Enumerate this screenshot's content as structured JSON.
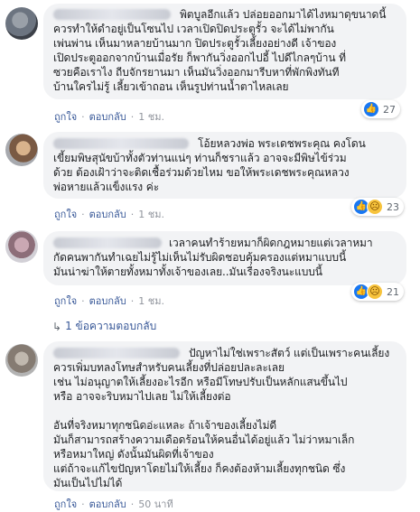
{
  "comments": [
    {
      "text": "พิตบูลอีกแล้ว ปล่อยออกมาได้ไงหมาดุขนาดนี้\nควรทำให้ดำอยู่เป็นโซนไป เวลาเปิดปิดประตูรั้ว จะได้ไม่พากัน\nเพ่นพ่าน เห็นมาหลายบ้านมาก ปิดประตูรั้วเลี้ยงอย่างดี เจ้าของ\nเปิดประตูออกจากบ้านเมื่อรัย ก็พากันวิ่งออกไปอี้ ไปดีไกลๆบ้าน ที่\nซวยคือเราไง ถีบจักรยานมา เห็นมันวิ่งออกมารีบหาที่พักพิงทันที\nบ้านใครไม่รู้ เลี้ยวเข้าถอน เห็นรูปท่านน้ำตาไหลเลย",
      "reaction_count": "27",
      "like": "ถูกใจ",
      "reply": "ตอบกลับ",
      "time": "1 ชม."
    },
    {
      "text": "โอ้ยหลวงพ่อ พระเดชพระคุณ คงโดน\nเขี้ยมพิษสุนัขบ้าทั้งตัวท่านแน่ๆ ท่านก็ชราแล้ว อาจจะมีพิษไข้ร่วม\nด้วย ต้องเฝ้าว่าจะติดเชื้อร่วมด้วยไหม ขอให้พระเดชพระคุณหลวง\nพ่อหายแล้วแข็งแรง ค่ะ",
      "reaction_count": "23",
      "like": "ถูกใจ",
      "reply": "ตอบกลับ",
      "time": "1 ชม."
    },
    {
      "text": "เวลาคนทำร้ายหมาก็ผิดกฎหมายแต่เวลาหมา\nกัดคนพากันทำเฉยไม่รู้ไม่เห็นไม่รับผิดชอบคุ้มครองแต่หมาแบบนี้\nมันน่าฆ่าให้ตายทั้งหมาทั้งเจ้าของเลย..มันเรื่องจริงนะแบบนี้",
      "reaction_count": "21",
      "like": "ถูกใจ",
      "reply": "ตอบกลับ",
      "time": "1 ชม.",
      "replies_label": "1 ข้อความตอบกลับ"
    },
    {
      "text": "ปัญหาไม่ใช่เพราะสัตว์ แต่เป็นเพราะคนเลี้ยง\nควรเพิ่มบทลงโทษสำหรับคนเลี้ยงที่ปล่อยปละละเลย\nเช่น ไม่อนุญาตให้เลี้ยงอะไรอีก หรือมีโทษปรับเป็นหลักแสนขึ้นไป\nหรือ อาจจะริบหมาไปเลย ไม่ให้เลี้ยงต่อ\n\nอันที่จริงหมาทุกชนิดอ่ะแหละ ถ้าเจ้าของเลี้ยงไม่ดี\nมันก็สามารถสร้างความเดือดร้อนให้คนอื่นได้อยู่แล้ว ไม่ว่าหมาเล็ก\nหรือหมาใหญ่ ดังนั้นมันผิดที่เจ้าของ\nแต่ถ้าจะแก้ไขปัญหาโดยไม่ให้เลี้ยง ก็คงต้องห้ามเลี้ยงทุกชนิด ซึ่ง\nมันเป็นไปไม่ได้",
      "like": "ถูกใจ",
      "reply": "ตอบกลับ",
      "time": "50 นาที"
    }
  ],
  "icons": [
    "like-icon",
    "sad-icon",
    "reply-arrow-icon"
  ],
  "colors": {
    "bubble": "#f2f3f5",
    "link": "#385898",
    "like_blue": "#1877f2",
    "sad_yellow": "#f7c33c",
    "meta_gray": "#90949c"
  }
}
